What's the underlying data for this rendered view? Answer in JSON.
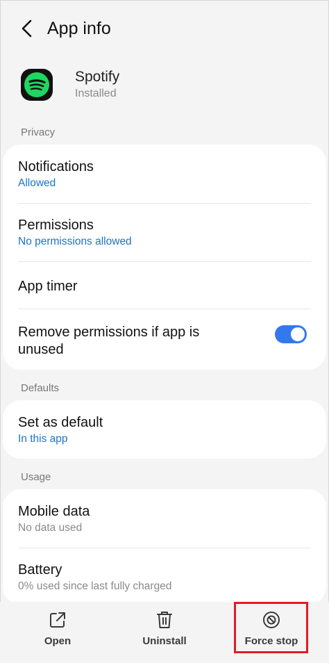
{
  "header": {
    "title": "App info",
    "back_icon": "chevron-left-icon"
  },
  "app": {
    "name": "Spotify",
    "status": "Installed",
    "brand_color": "#1ed760"
  },
  "sections": {
    "privacy": "Privacy",
    "defaults": "Defaults",
    "usage": "Usage"
  },
  "privacy": {
    "notifications": {
      "title": "Notifications",
      "value": "Allowed"
    },
    "permissions": {
      "title": "Permissions",
      "value": "No permissions allowed"
    },
    "app_timer": {
      "title": "App timer"
    },
    "remove_permissions": {
      "title_line1": "Remove permissions if app is",
      "title_line2": "unused",
      "enabled": true
    }
  },
  "defaults": {
    "set_default": {
      "title": "Set as default",
      "value": "In this app"
    }
  },
  "usage": {
    "mobile_data": {
      "title": "Mobile data",
      "value": "No data used"
    },
    "battery": {
      "title": "Battery",
      "value": "0% used since last fully charged"
    }
  },
  "bottom": {
    "open": "Open",
    "uninstall": "Uninstall",
    "force_stop": "Force stop"
  },
  "colors": {
    "accent": "#1a73c8",
    "toggle": "#3478f0",
    "highlight": "#e21b24"
  }
}
